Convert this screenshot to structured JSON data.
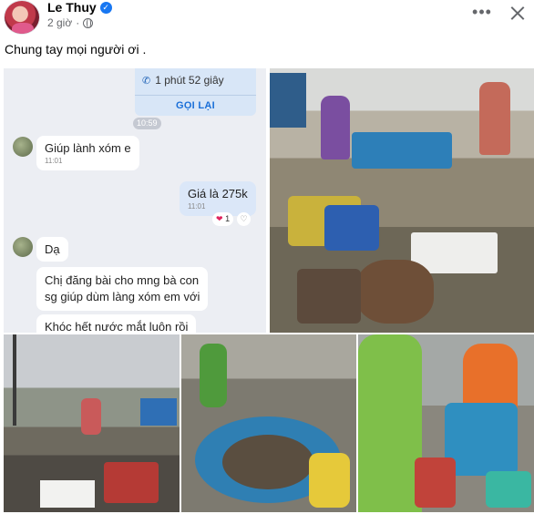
{
  "post": {
    "author": "Le Thuy",
    "time": "2 giờ",
    "caption": "Chung tay mọi người ơi .",
    "more_label": "•••",
    "verified_mark": "✓"
  },
  "icons": {
    "verified": "verified-badge-icon",
    "audience": "globe-icon",
    "more": "more-options-icon",
    "close": "close-icon",
    "call": "phone-icon"
  },
  "colors": {
    "verified_blue": "#1877f2",
    "meta_gray": "#65676b",
    "callback_blue": "#1a6fd8"
  },
  "chat": {
    "call_duration": "1 phút 52 giây",
    "callback": "GỌI LẠI",
    "time_divider": "10:59",
    "messages": [
      {
        "text": "Giúp lành xóm e",
        "time": "11:01"
      },
      {
        "text": "Giá là 275k",
        "time": "11:01",
        "reaction_count": "1"
      },
      {
        "text": "Dạ"
      },
      {
        "text_line1": "Chị đăng bài cho mng bà con",
        "text_line2": "sg giúp dùm làng xóm em với"
      },
      {
        "text": "Khóc hết nước mắt luôn rồi"
      }
    ],
    "reaction": "❤",
    "add_reaction": "♡"
  }
}
